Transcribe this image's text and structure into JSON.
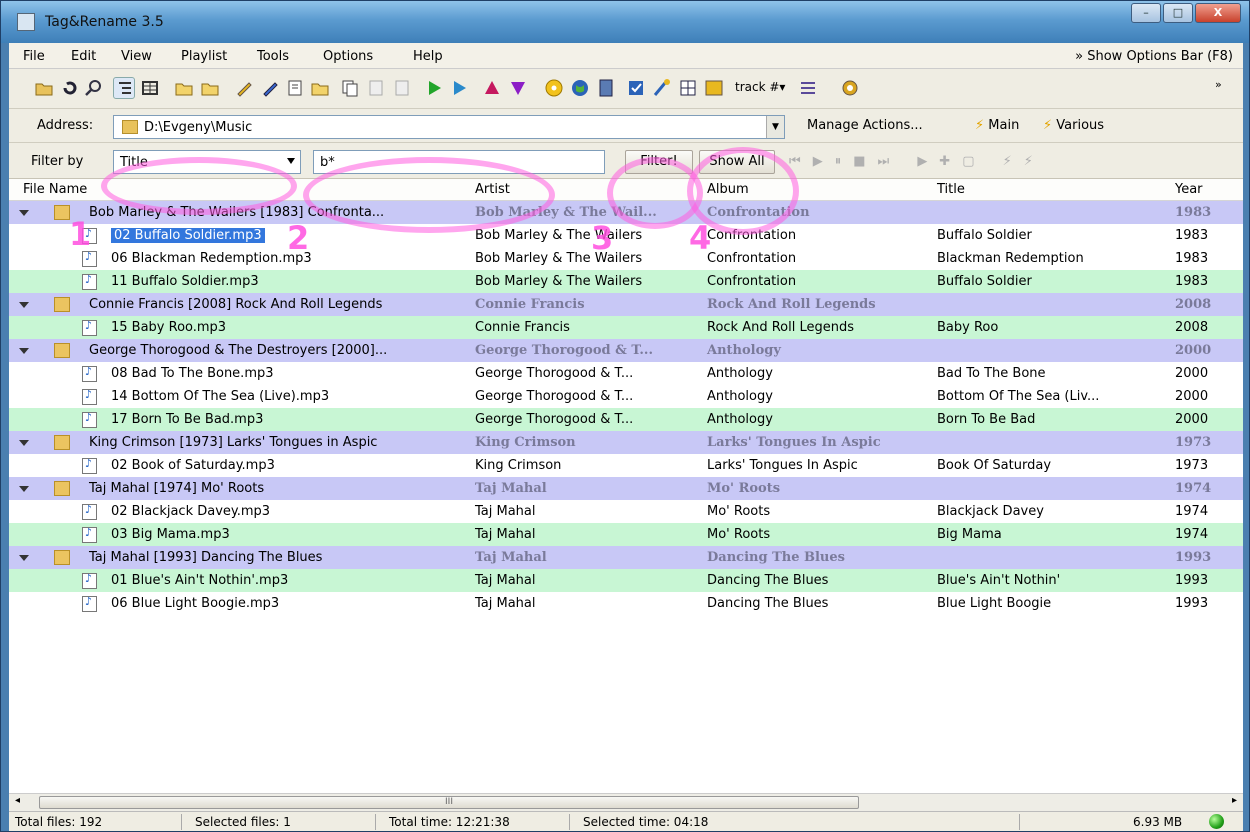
{
  "app": {
    "title": "Tag&Rename 3.5"
  },
  "caption": {
    "min": "–",
    "max": "□",
    "close": "X"
  },
  "menu": {
    "items": [
      "File",
      "Edit",
      "View",
      "Playlist",
      "Tools",
      "Options",
      "Help"
    ],
    "show_options": "» Show Options Bar (F8)"
  },
  "toolbar": {
    "track_label": "track #▾"
  },
  "address": {
    "label": "Address:",
    "value": "D:\\Evgeny\\Music"
  },
  "actions": {
    "manage": "Manage Actions...",
    "main": "Main",
    "various": "Various"
  },
  "filter": {
    "label": "Filter by",
    "field": "Title",
    "query": "b*",
    "filter_btn": "Filter!",
    "show_all_btn": "Show All"
  },
  "columns": [
    "File Name",
    "Artist",
    "Album",
    "Title",
    "Year"
  ],
  "rows": [
    {
      "type": "group",
      "name": "Bob Marley & The Wailers [1983] Confronta...",
      "artist": "Bob Marley & The Wail...",
      "album": "Confrontation",
      "title": "",
      "year": "1983"
    },
    {
      "type": "file",
      "name": "02 Buffalo Soldier.mp3",
      "artist": "Bob Marley & The Wailers",
      "album": "Confrontation",
      "title": "Buffalo Soldier",
      "year": "1983",
      "selected": true
    },
    {
      "type": "file",
      "name": "06 Blackman Redemption.mp3",
      "artist": "Bob Marley & The Wailers",
      "album": "Confrontation",
      "title": "Blackman Redemption",
      "year": "1983"
    },
    {
      "type": "file",
      "name": "11 Buffalo Soldier.mp3",
      "artist": "Bob Marley & The Wailers",
      "album": "Confrontation",
      "title": "Buffalo Soldier",
      "year": "1983",
      "green": true
    },
    {
      "type": "group",
      "name": "Connie Francis [2008] Rock And Roll Legends",
      "artist": "Connie Francis",
      "album": "Rock And Roll Legends",
      "title": "",
      "year": "2008"
    },
    {
      "type": "file",
      "name": "15 Baby Roo.mp3",
      "artist": "Connie Francis",
      "album": "Rock And Roll Legends",
      "title": "Baby Roo",
      "year": "2008",
      "green": true
    },
    {
      "type": "group",
      "name": "George Thorogood & The Destroyers [2000]...",
      "artist": "George Thorogood & T...",
      "album": "Anthology",
      "title": "",
      "year": "2000"
    },
    {
      "type": "file",
      "name": "08 Bad To The Bone.mp3",
      "artist": "George Thorogood & T...",
      "album": "Anthology",
      "title": "Bad To The Bone",
      "year": "2000"
    },
    {
      "type": "file",
      "name": "14 Bottom Of The Sea (Live).mp3",
      "artist": "George Thorogood & T...",
      "album": "Anthology",
      "title": "Bottom Of The Sea (Liv...",
      "year": "2000"
    },
    {
      "type": "file",
      "name": "17 Born To Be Bad.mp3",
      "artist": "George Thorogood & T...",
      "album": "Anthology",
      "title": "Born To Be Bad",
      "year": "2000",
      "green": true
    },
    {
      "type": "group",
      "name": "King Crimson [1973] Larks' Tongues in Aspic",
      "artist": "King Crimson",
      "album": "Larks' Tongues In Aspic",
      "title": "",
      "year": "1973"
    },
    {
      "type": "file",
      "name": "02 Book of Saturday.mp3",
      "artist": "King Crimson",
      "album": "Larks' Tongues In Aspic",
      "title": "Book Of Saturday",
      "year": "1973"
    },
    {
      "type": "group",
      "name": "Taj Mahal [1974] Mo' Roots",
      "artist": "Taj Mahal",
      "album": "Mo' Roots",
      "title": "",
      "year": "1974"
    },
    {
      "type": "file",
      "name": "02 Blackjack Davey.mp3",
      "artist": "Taj Mahal",
      "album": "Mo' Roots",
      "title": "Blackjack Davey",
      "year": "1974"
    },
    {
      "type": "file",
      "name": "03 Big Mama.mp3",
      "artist": "Taj Mahal",
      "album": "Mo' Roots",
      "title": "Big Mama",
      "year": "1974",
      "green": true
    },
    {
      "type": "group",
      "name": "Taj Mahal [1993] Dancing The Blues",
      "artist": "Taj Mahal",
      "album": "Dancing The Blues",
      "title": "",
      "year": "1993"
    },
    {
      "type": "file",
      "name": "01 Blue's Ain't Nothin'.mp3",
      "artist": "Taj Mahal",
      "album": "Dancing The Blues",
      "title": "Blue's Ain't Nothin'",
      "year": "1993",
      "green": true
    },
    {
      "type": "file",
      "name": "06 Blue Light Boogie.mp3",
      "artist": "Taj Mahal",
      "album": "Dancing The Blues",
      "title": "Blue Light Boogie",
      "year": "1993"
    }
  ],
  "scroll": {
    "thumb": "III"
  },
  "status": {
    "total_files": "Total files: 192",
    "selected_files": "Selected files: 1",
    "total_time": "Total time: 12:21:38",
    "selected_time": "Selected time: 04:18",
    "size": "6.93 MB"
  },
  "annotations": [
    "1",
    "2",
    "3",
    "4"
  ],
  "colors": {
    "group_row": "#c8c8f6",
    "highlight_row": "#c8f6d4",
    "selection": "#3377dd",
    "annotation": "#ff4fe0"
  }
}
